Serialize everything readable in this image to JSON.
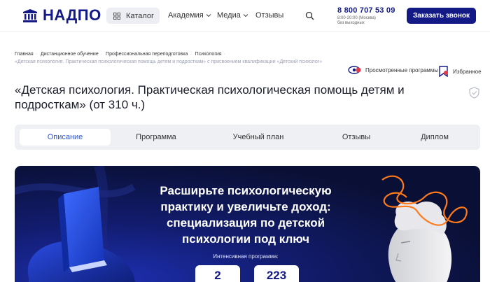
{
  "header": {
    "logo_text": "НАДПО",
    "catalog_label": "Каталог",
    "nav": [
      {
        "label": "Академия",
        "has_chevron": true
      },
      {
        "label": "Медиа",
        "has_chevron": true
      },
      {
        "label": "Отзывы",
        "has_chevron": false
      }
    ],
    "phone": "8 800 707 53 09",
    "phone_hours": "8:00-20:00 (Москва)",
    "phone_days": "без выходных",
    "call_button": "Заказать звонок",
    "brand_color": "#131a86"
  },
  "breadcrumbs": {
    "items": [
      "Главная",
      "Дистанционное обучение",
      "Профессиональная переподготовка",
      "Психология"
    ],
    "current": "«Детская психология. Практическая психологическая помощь детям и подросткам» с присвоением квалификации «Детский психолог»"
  },
  "tools": {
    "viewed": "Просмотренные программы",
    "favorites": "Избранное"
  },
  "page_title": "«Детская психология. Практическая психологическая помощь детям и подросткам» (от 310 ч.)",
  "tabs": [
    {
      "label": "Описание",
      "active": true
    },
    {
      "label": "Программа",
      "active": false
    },
    {
      "label": "Учебный план",
      "active": false
    },
    {
      "label": "Отзывы",
      "active": false
    },
    {
      "label": "Диплом",
      "active": false
    }
  ],
  "banner": {
    "title": "Расширьте психологическую практику и увеличьте доход: специализация по детской психологии под ключ",
    "subtitle": "Интенсивная программа:",
    "stats": [
      "2",
      "223"
    ]
  }
}
